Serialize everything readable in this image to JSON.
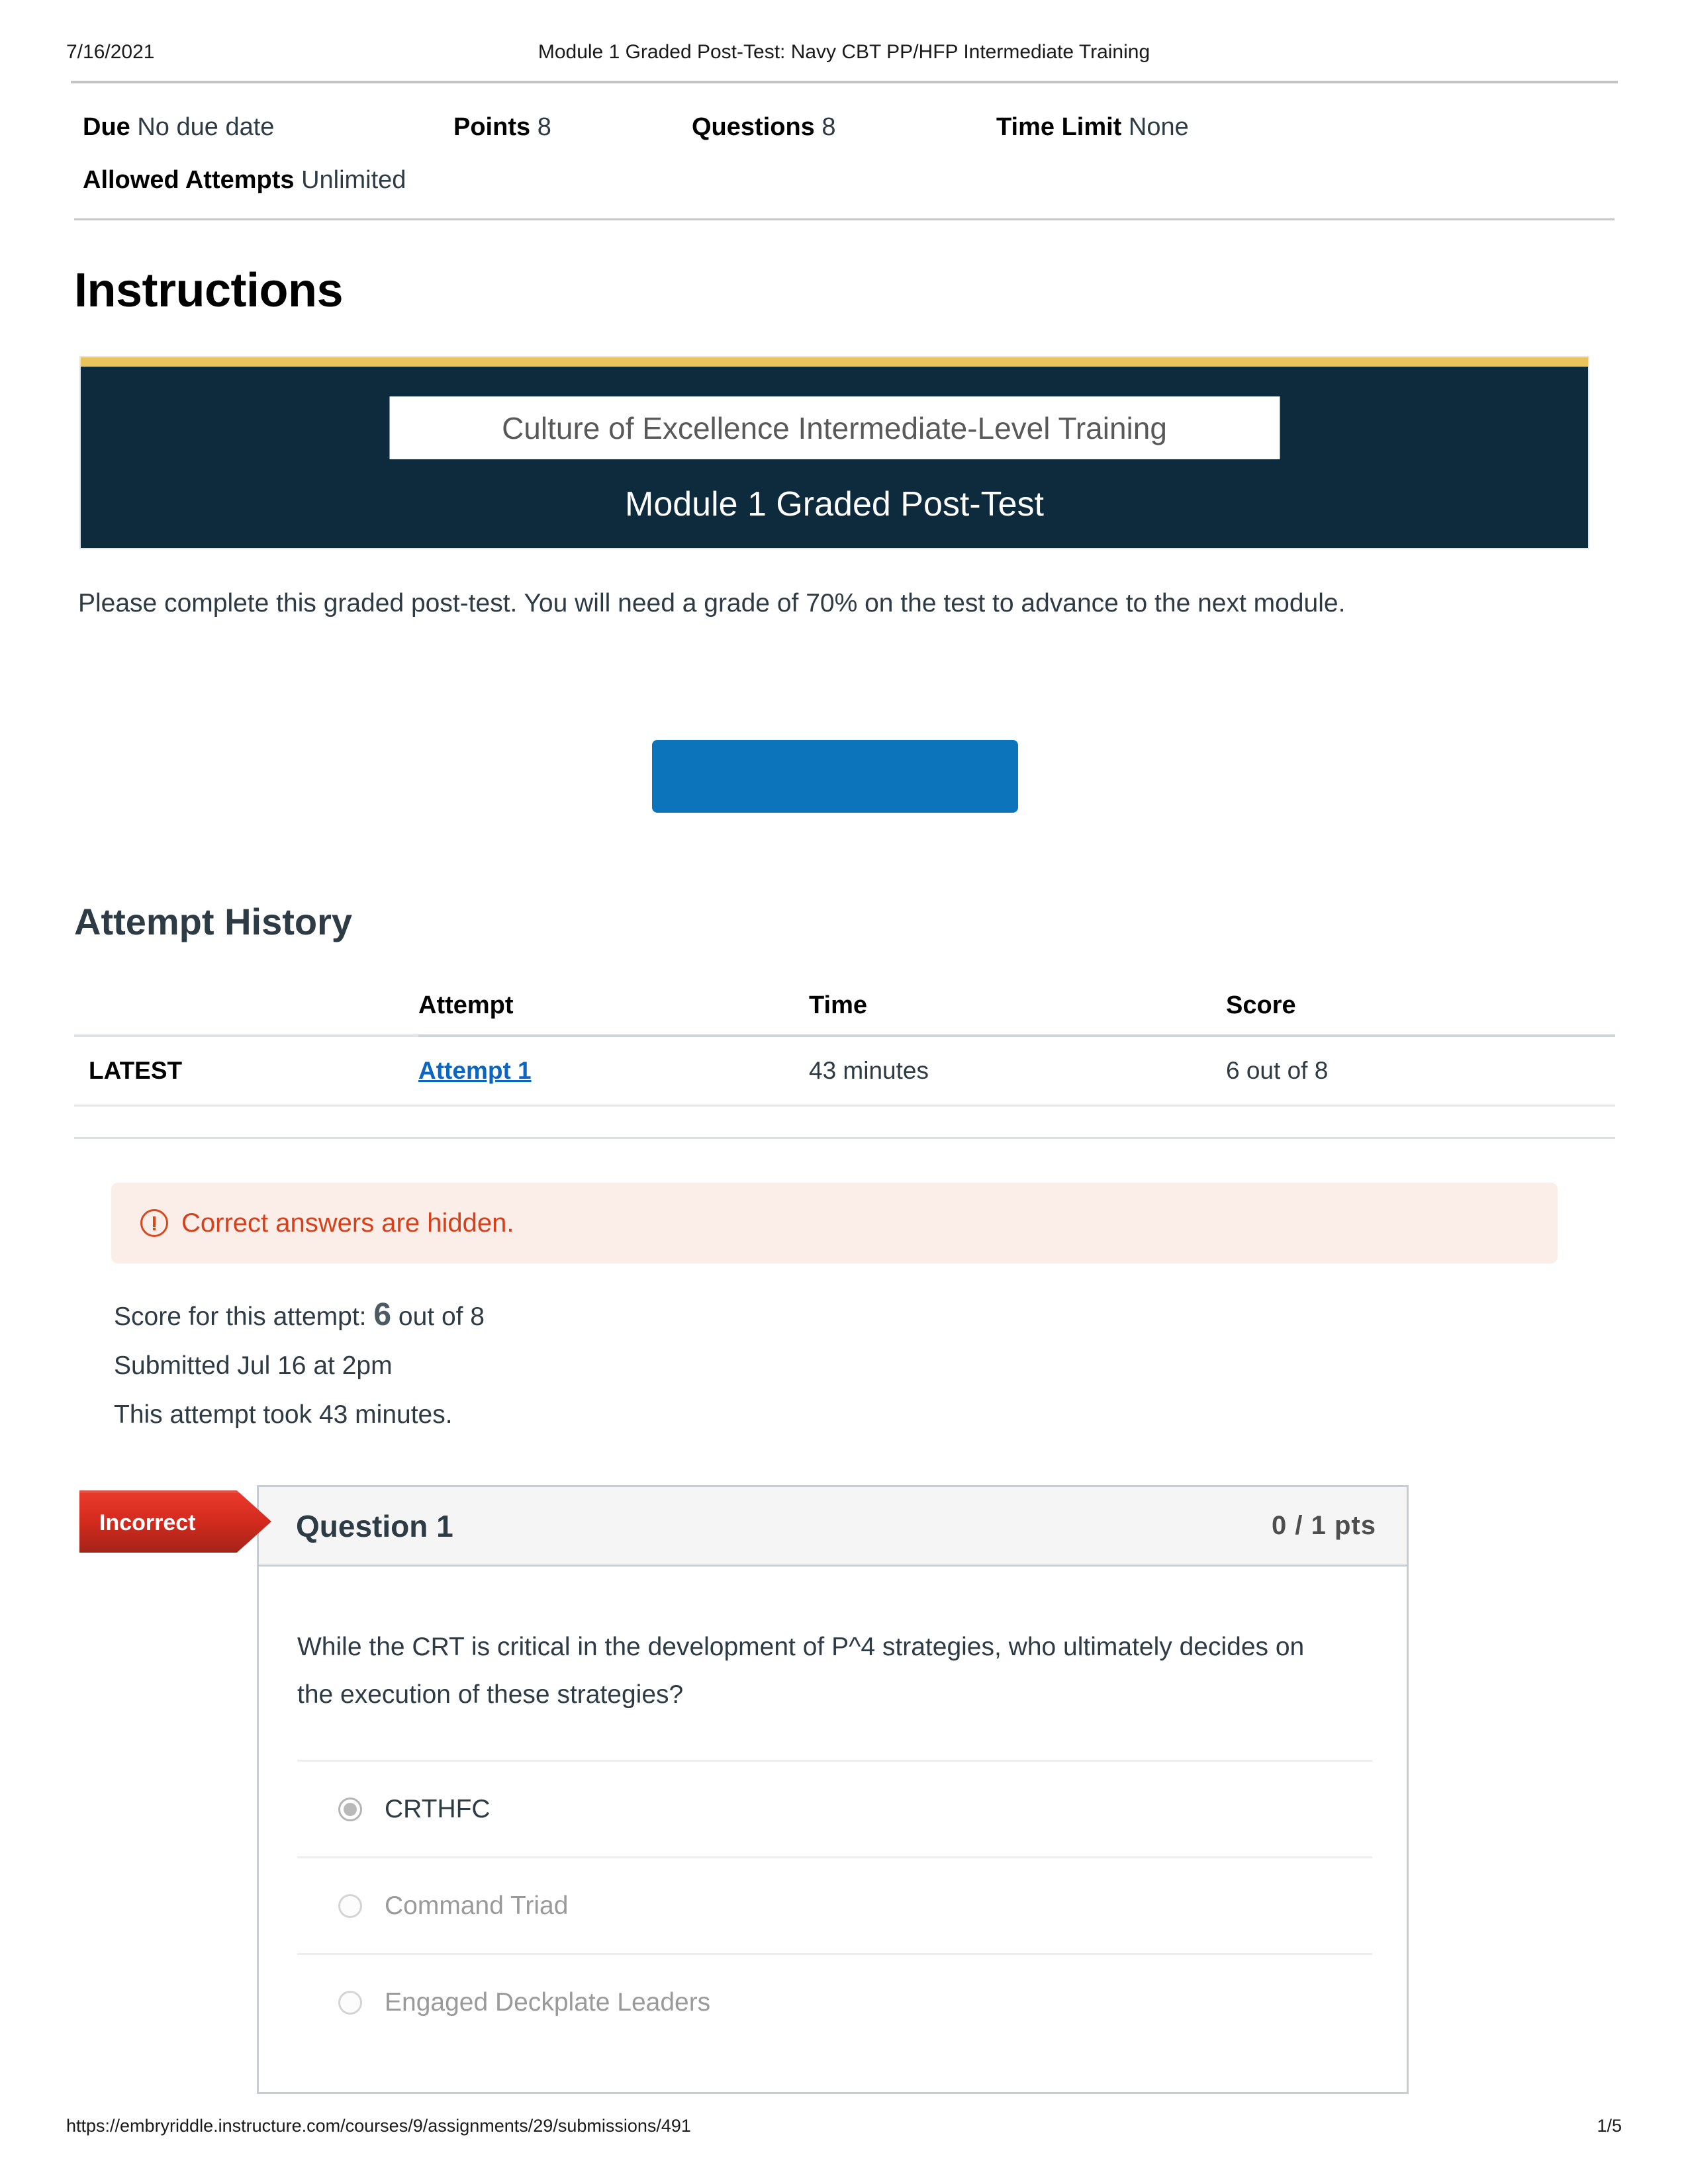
{
  "print_header": {
    "date": "7/16/2021",
    "title": "Module 1 Graded Post-Test: Navy CBT PP/HFP Intermediate Training"
  },
  "meta": {
    "due_label": "Due",
    "due_value": "No due date",
    "points_label": "Points",
    "points_value": "8",
    "questions_label": "Questions",
    "questions_value": "8",
    "time_limit_label": "Time Limit",
    "time_limit_value": "None",
    "attempts_label": "Allowed Attempts",
    "attempts_value": "Unlimited"
  },
  "instructions": {
    "heading": "Instructions",
    "paragraph": "Please complete this graded post-test. You will need a grade of 70% on the test to advance to the next module."
  },
  "banner": {
    "inner_label": "Culture of Excellence Intermediate-Level Training",
    "title": "Module 1 Graded Post-Test",
    "bg_color": "#0e2b3e",
    "accent_color": "#e9c35c"
  },
  "blue_button": {
    "label": "",
    "color": "#0b74ba"
  },
  "attempt_history": {
    "heading": "Attempt History",
    "columns": [
      "",
      "Attempt",
      "Time",
      "Score"
    ],
    "rows": [
      {
        "flag": "LATEST",
        "attempt": "Attempt 1 ",
        "time": "43 minutes",
        "score": "6 out of 8"
      }
    ]
  },
  "alert": {
    "icon": "exclamation-circle-icon",
    "text": "Correct answers are hidden.",
    "bg_color": "#fbeee9",
    "text_color": "#d6401a"
  },
  "summary": {
    "score_prefix": "Score for this attempt:",
    "score_value": "6",
    "score_suffix": "out of 8",
    "submitted": "Submitted Jul 16 at 2pm",
    "duration": "This attempt took 43 minutes."
  },
  "question": {
    "status_flag": "Incorrect",
    "title": "Question 1",
    "points": "0 / 1 pts",
    "text": "While the CRT is critical in the development of P^4 strategies, who ultimately decides on the execution of these strategies?",
    "answers": [
      {
        "label": "CRTHFC",
        "selected": true
      },
      {
        "label": "Command Triad",
        "selected": false
      },
      {
        "label": "Engaged Deckplate Leaders",
        "selected": false
      }
    ]
  },
  "print_footer": {
    "url": "https://embryriddle.instructure.com/courses/9/assignments/29/submissions/491",
    "page": "1/5"
  }
}
